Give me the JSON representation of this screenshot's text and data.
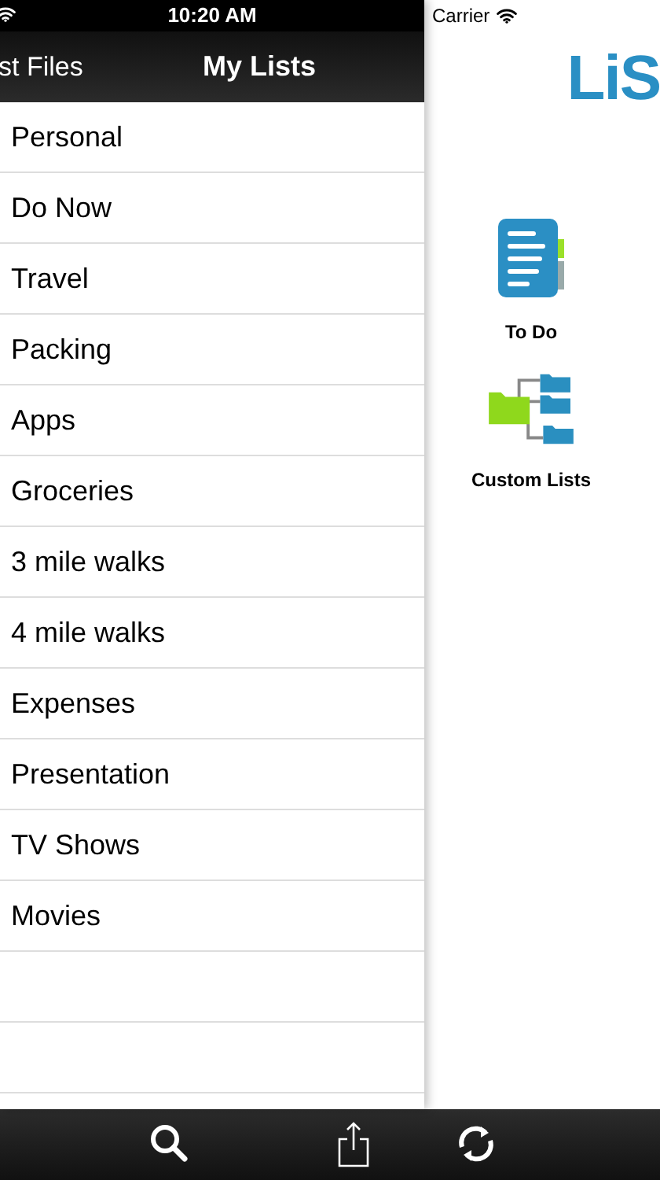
{
  "status_bar": {
    "time": "10:20 AM",
    "carrier": "Carrier"
  },
  "nav_bar": {
    "back_label": "st Files",
    "title": "My Lists"
  },
  "lists": [
    "Personal",
    "Do Now",
    "Travel",
    "Packing",
    "Apps",
    "Groceries",
    "3 mile walks",
    "4 mile walks",
    "Expenses",
    "Presentation",
    "TV Shows",
    "Movies"
  ],
  "home": {
    "logo": "LiS",
    "tiles": [
      {
        "kind": "todo",
        "label": "To Do"
      },
      {
        "kind": "custom",
        "label": "Custom Lists"
      }
    ]
  },
  "toolbar": [
    {
      "kind": "search"
    },
    {
      "kind": "share"
    },
    {
      "kind": "refresh"
    }
  ]
}
